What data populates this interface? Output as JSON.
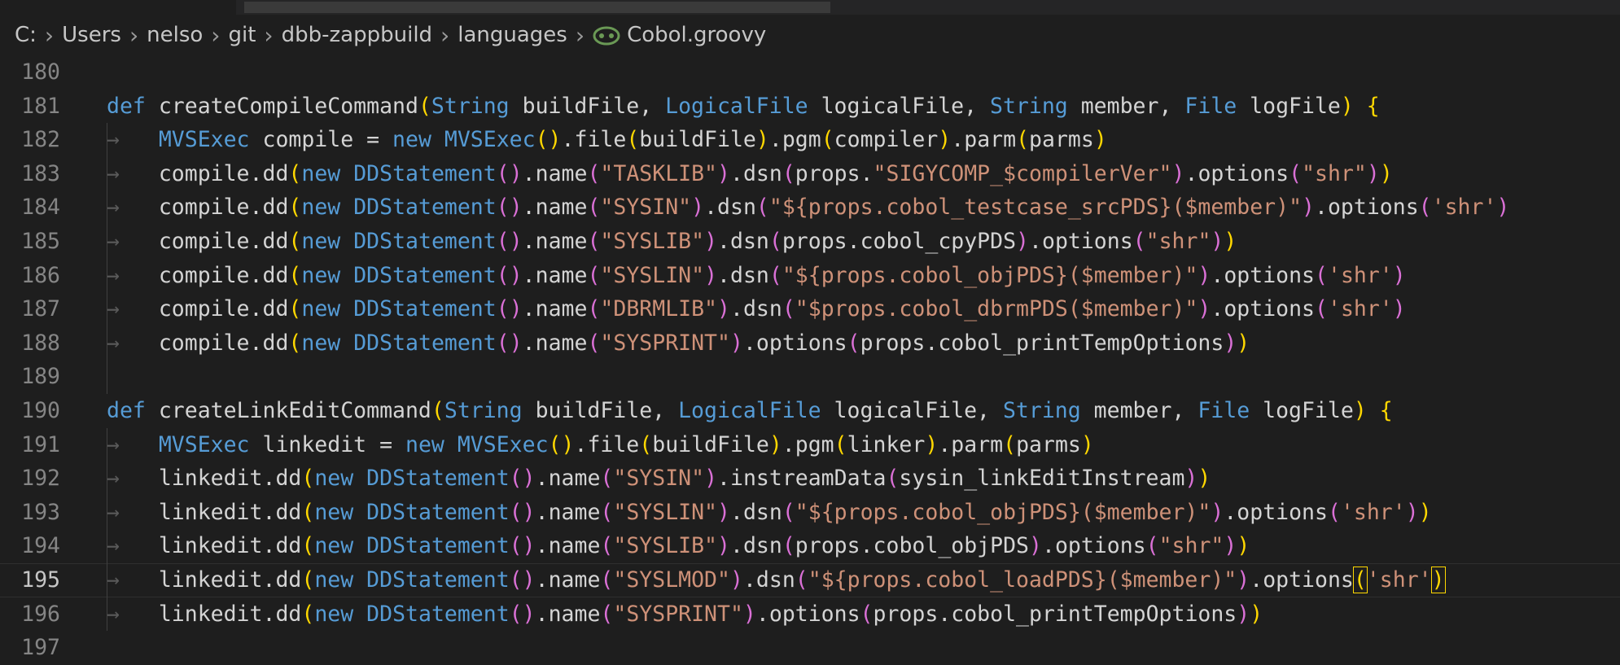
{
  "breadcrumb": {
    "parts": [
      "C:",
      "Users",
      "nelso",
      "git",
      "dbb-zappbuild",
      "languages"
    ],
    "file": "Cobol.groovy"
  },
  "editor": {
    "lines": [
      {
        "num": "180",
        "text": ""
      },
      {
        "num": "181",
        "text": "def createCompileCommand(String buildFile, LogicalFile logicalFile, String member, File logFile) {"
      },
      {
        "num": "182",
        "text": "    MVSExec compile = new MVSExec().file(buildFile).pgm(compiler).parm(parms)"
      },
      {
        "num": "183",
        "text": "    compile.dd(new DDStatement().name(\"TASKLIB\").dsn(props.\"SIGYCOMP_$compilerVer\").options(\"shr\"))"
      },
      {
        "num": "184",
        "text": "    compile.dd(new DDStatement().name(\"SYSIN\").dsn(\"${props.cobol_testcase_srcPDS}($member)\").options('shr')"
      },
      {
        "num": "185",
        "text": "    compile.dd(new DDStatement().name(\"SYSLIB\").dsn(props.cobol_cpyPDS).options(\"shr\"))"
      },
      {
        "num": "186",
        "text": "    compile.dd(new DDStatement().name(\"SYSLIN\").dsn(\"${props.cobol_objPDS}($member)\").options('shr')"
      },
      {
        "num": "187",
        "text": "    compile.dd(new DDStatement().name(\"DBRMLIB\").dsn(\"$props.cobol_dbrmPDS($member)\").options('shr')"
      },
      {
        "num": "188",
        "text": "    compile.dd(new DDStatement().name(\"SYSPRINT\").options(props.cobol_printTempOptions))"
      },
      {
        "num": "189",
        "text": ""
      },
      {
        "num": "190",
        "text": "def createLinkEditCommand(String buildFile, LogicalFile logicalFile, String member, File logFile) {"
      },
      {
        "num": "191",
        "text": "    MVSExec linkedit = new MVSExec().file(buildFile).pgm(linker).parm(parms)"
      },
      {
        "num": "192",
        "text": "    linkedit.dd(new DDStatement().name(\"SYSIN\").instreamData(sysin_linkEditInstream))"
      },
      {
        "num": "193",
        "text": "    linkedit.dd(new DDStatement().name(\"SYSLIN\").dsn(\"${props.cobol_objPDS}($member)\").options('shr'))"
      },
      {
        "num": "194",
        "text": "    linkedit.dd(new DDStatement().name(\"SYSLIB\").dsn(props.cobol_objPDS).options(\"shr\"))"
      },
      {
        "num": "195",
        "text": "    linkedit.dd(new DDStatement().name(\"SYSLMOD\").dsn(\"${props.cobol_loadPDS}($member)\").options('shr')"
      },
      {
        "num": "196",
        "text": "    linkedit.dd(new DDStatement().name(\"SYSPRINT\").options(props.cobol_printTempOptions))"
      },
      {
        "num": "197",
        "text": ""
      }
    ],
    "cursor_line": "195"
  },
  "colors": {
    "background": "#1e1e1e",
    "keyword": "#569cd6",
    "string": "#ce9178",
    "bracket_gold": "#ffd700",
    "bracket_orchid": "#da70d6",
    "bracket_blue": "#179fff"
  }
}
